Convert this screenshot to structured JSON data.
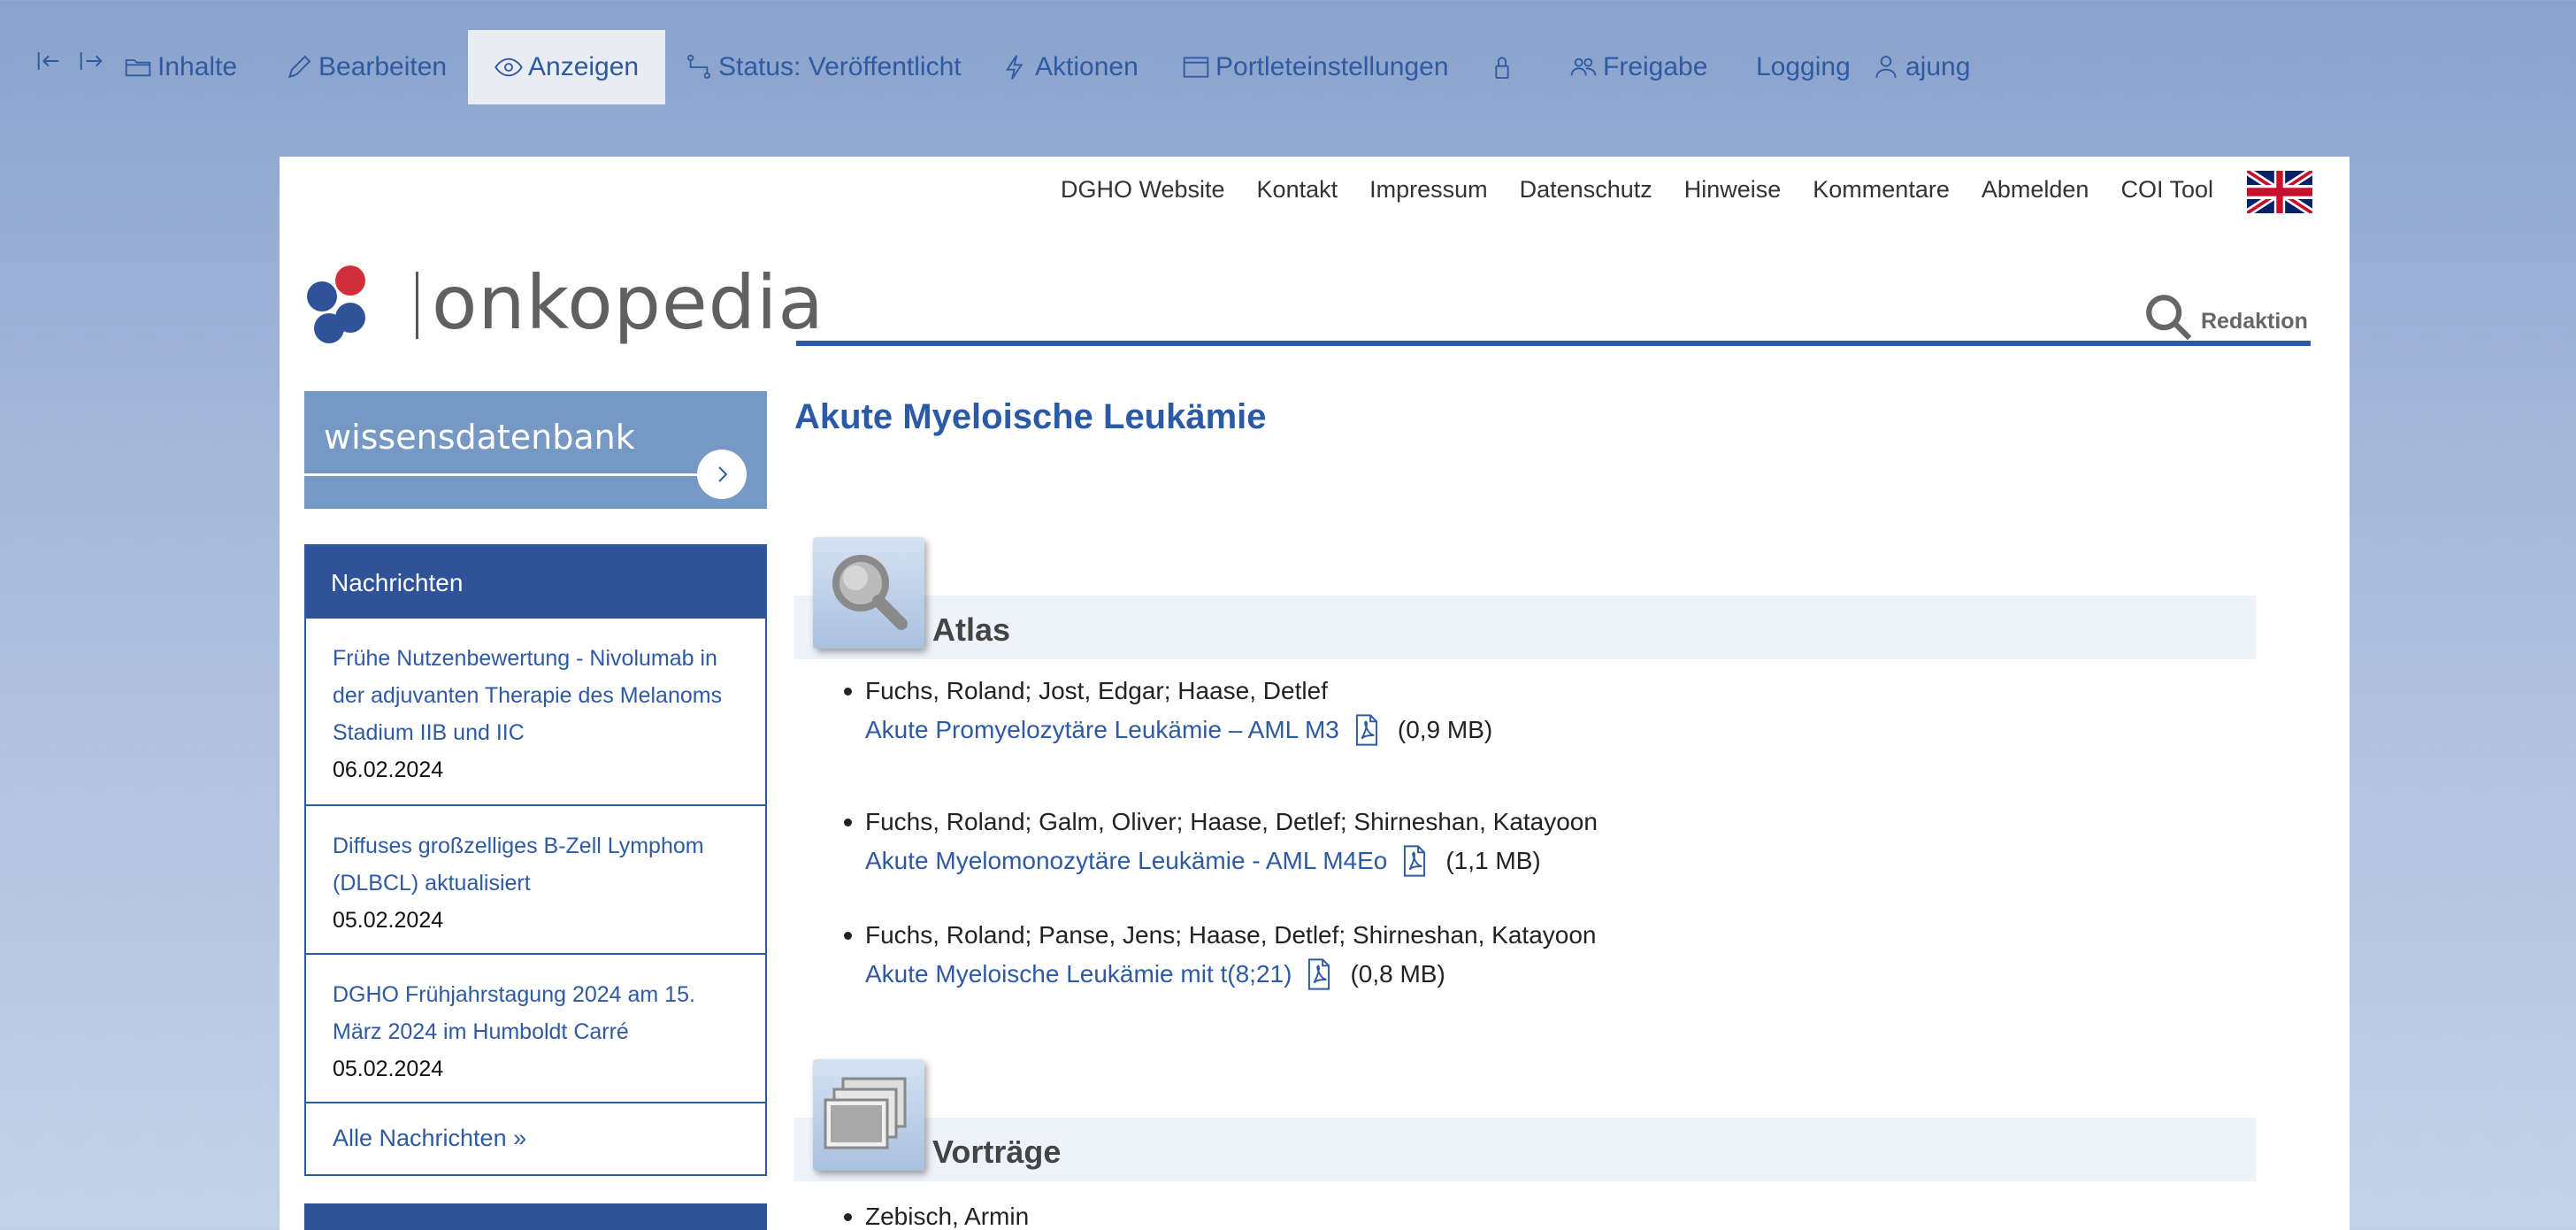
{
  "toolbar": {
    "items": [
      {
        "label": "Inhalte",
        "icon": "folder-icon"
      },
      {
        "label": "Bearbeiten",
        "icon": "pencil-icon"
      },
      {
        "label": "Anzeigen",
        "icon": "eye-icon",
        "active": true
      },
      {
        "label": "Status: Veröffentlicht",
        "icon": "workflow-icon"
      },
      {
        "label": "Aktionen",
        "icon": "lightning-icon"
      },
      {
        "label": "Portleteinstellungen",
        "icon": "window-icon"
      },
      {
        "label": "",
        "icon": "lock-icon"
      },
      {
        "label": "Freigabe",
        "icon": "people-icon"
      },
      {
        "label": "Logging",
        "icon": ""
      },
      {
        "label": "ajung",
        "icon": "user-icon"
      }
    ],
    "accent": "#2e5aa3"
  },
  "topnav": [
    "DGHO Website",
    "Kontakt",
    "Impressum",
    "Datenschutz",
    "Hinweise",
    "Kommentare",
    "Abmelden",
    "COI Tool"
  ],
  "logo": {
    "word": "onkopedia"
  },
  "search": {
    "label": "Redaktion"
  },
  "sidebar": {
    "wissensdatenbank": "wissensdatenbank",
    "news": {
      "title": "Nachrichten",
      "items": [
        {
          "title": "Frühe Nutzenbewertung - Nivolumab in der adjuvanten Therapie des Melanoms Stadium IIB und IIC",
          "date": "06.02.2024"
        },
        {
          "title": "Diffuses großzelliges B-Zell Lymphom (DLBCL) aktualisiert",
          "date": "05.02.2024"
        },
        {
          "title": "DGHO Frühjahrstagung 2024 am 15. März 2024 im Humboldt Carré",
          "date": "05.02.2024"
        }
      ],
      "all_link": "Alle Nachrichten »"
    }
  },
  "main": {
    "title": "Akute Myeloische Leukämie",
    "sections": [
      {
        "title": "Atlas",
        "entries": [
          {
            "authors": "Fuchs, Roland; Jost, Edgar; Haase, Detlef",
            "link": "Akute Promyelozytäre Leukämie – AML M3",
            "size": "(0,9 MB)"
          },
          {
            "authors": "Fuchs, Roland; Galm, Oliver; Haase, Detlef; Shirneshan, Katayoon",
            "link": "Akute Myelomonozytäre Leukämie - AML M4Eo",
            "size": "(1,1 MB)"
          },
          {
            "authors": "Fuchs, Roland; Panse, Jens; Haase, Detlef; Shirneshan, Katayoon",
            "link": "Akute Myeloische Leukämie mit t(8;21)",
            "size": "(0,8 MB)"
          }
        ]
      },
      {
        "title": "Vorträge",
        "entries": [
          {
            "authors": "Zebisch, Armin"
          }
        ]
      }
    ]
  }
}
